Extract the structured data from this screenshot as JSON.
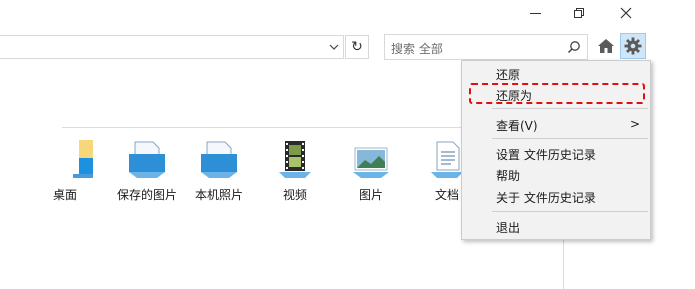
{
  "window_controls": {
    "minimize": "—",
    "restore": "❐",
    "close": "✕"
  },
  "toolbar": {
    "search_placeholder": "搜索 全部",
    "refresh_glyph": "↻"
  },
  "files": [
    {
      "label": "桌面",
      "icon": "desktop-folder-icon"
    },
    {
      "label": "保存的图片",
      "icon": "saved-pictures-icon"
    },
    {
      "label": "本机照片",
      "icon": "camera-roll-icon"
    },
    {
      "label": "视频",
      "icon": "video-icon"
    },
    {
      "label": "图片",
      "icon": "pictures-icon"
    },
    {
      "label": "文档",
      "icon": "documents-icon"
    }
  ],
  "menu": {
    "items": [
      {
        "label": "还原"
      },
      {
        "label": "还原为"
      },
      {
        "label": "查看(V)",
        "arrow": ">"
      },
      {
        "label": "设置 文件历史记录"
      },
      {
        "label": "帮助"
      },
      {
        "label": "关于 文件历史记录"
      },
      {
        "label": "退出"
      }
    ]
  },
  "colors": {
    "highlight": "#e01010",
    "menu_bg": "#f2f2f2",
    "gear_bg": "#cfe6f8"
  }
}
